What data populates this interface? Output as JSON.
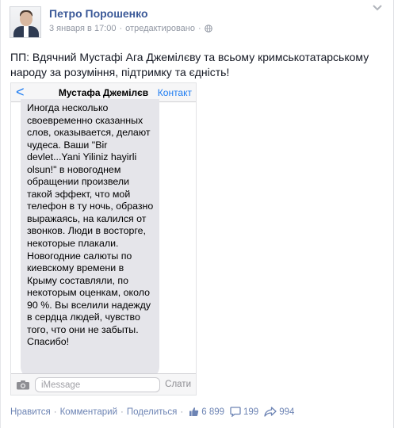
{
  "post": {
    "author": "Петро Порошенко",
    "timestamp": "3 января в 17:00",
    "edited": "отредактировано",
    "separator": "·",
    "text": "ПП: Вдячний Мустафі Ага Джемілєву та всьому кримськотатарському народу за розуміння, підтримку та єдність!",
    "audience_icon": "globe-icon",
    "menu_icon": "chevron-down-icon"
  },
  "screenshot": {
    "back_glyph": "<",
    "contact_name": "Мустафа Джемілєв",
    "contact_button": "Контакт",
    "message": "Иногда несколько своевременно сказанных слов, оказывается, делают чудеса. Ваши \"Bir devlet...Yani Yiliniz hayirli olsun!\" в новогоднем обращении произвели такой эффект, что мой телефон в ту ночь, образно выражаясь, на калился от звонков. Люди в восторге, некоторые плакали. Новогодние салюты по киевскому времени в Крыму составляли, по некоторым оценкам, около 90 %. Вы вселили надежду в сердца людей, чувство того, что они не забыты. Спасибо!",
    "input_placeholder": "iMessage",
    "send_label": "Слати",
    "camera_icon": "camera-icon"
  },
  "actions": {
    "like": "Нравится",
    "comment": "Комментарий",
    "share": "Поделиться",
    "separator": "·",
    "likes_count": "6 899",
    "comments_count": "199",
    "shares_count": "994"
  },
  "colors": {
    "link": "#3b5998",
    "ios_blue": "#1d7cf2",
    "bubble": "#e5e5ea",
    "meta": "#9197a3"
  }
}
